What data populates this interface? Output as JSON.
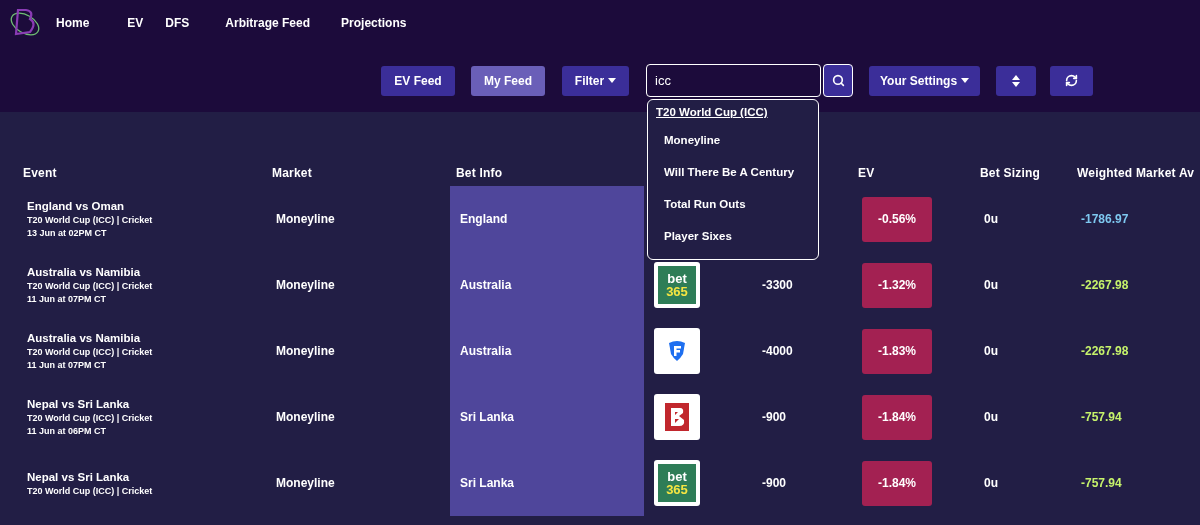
{
  "nav": {
    "items": [
      {
        "label": "Home"
      },
      {
        "label": "EV"
      },
      {
        "label": "DFS"
      },
      {
        "label": "Arbitrage Feed"
      },
      {
        "label": "Projections"
      }
    ]
  },
  "toolbar": {
    "feeds": [
      {
        "label": "EV Feed",
        "selected": false
      },
      {
        "label": "My Feed",
        "selected": true
      }
    ],
    "filter": {
      "label": "Filter"
    },
    "search": {
      "value": "icc"
    },
    "settings": {
      "label": "Your Settings"
    }
  },
  "search_dropdown": {
    "group": "T20 World Cup (ICC)",
    "items": [
      {
        "label": "Moneyline"
      },
      {
        "label": "Will There Be A Century"
      },
      {
        "label": "Total Run Outs"
      },
      {
        "label": "Player Sixes"
      }
    ]
  },
  "feed": {
    "columns": [
      {
        "label": "Event"
      },
      {
        "label": "Market"
      },
      {
        "label": "Bet Info"
      },
      {},
      {},
      {
        "label": "EV"
      },
      {
        "label": "Bet Sizing"
      },
      {
        "label": "Weighted Market Av"
      }
    ],
    "rows": [
      {
        "event": "England vs Oman",
        "league": "T20 World Cup (ICC) | Cricket",
        "time": "13 Jun at 02PM CT",
        "market": "Moneyline",
        "bet_info": "England",
        "ev": "-0.56%",
        "sizing": "0u",
        "weighted": "-1786.97",
        "color": "#7ec8f0"
      },
      {
        "event": "Australia vs Namibia",
        "league": "T20 World Cup (ICC) | Cricket",
        "time": "11 Jun at 07PM CT",
        "market": "Moneyline",
        "bet_info": "Australia",
        "book": {
          "kind": "bet365",
          "logo_text": [
            "bet",
            "365"
          ]
        },
        "price": "-3300",
        "ev": "-1.32%",
        "sizing": "0u",
        "weighted": "-2267.98",
        "color": "#c6f36b"
      },
      {
        "event": "Australia vs Namibia",
        "league": "T20 World Cup (ICC) | Cricket",
        "time": "11 Jun at 07PM CT",
        "market": "Moneyline",
        "bet_info": "Australia",
        "book": {
          "kind": "shield"
        },
        "price": "-4000",
        "ev": "-1.83%",
        "sizing": "0u",
        "weighted": "-2267.98",
        "color": "#c6f36b"
      },
      {
        "event": "Nepal vs Sri Lanka",
        "league": "T20 World Cup (ICC) | Cricket",
        "time": "11 Jun at 06PM CT",
        "market": "Moneyline",
        "bet_info": "Sri Lanka",
        "book": {
          "kind": "redb"
        },
        "price": "-900",
        "ev": "-1.84%",
        "sizing": "0u",
        "weighted": "-757.94",
        "color": "#c6f36b"
      },
      {
        "event": "Nepal vs Sri Lanka",
        "league": "T20 World Cup (ICC) | Cricket",
        "market": "Moneyline",
        "bet_info": "Sri Lanka",
        "book": {
          "kind": "bet365",
          "logo_text": [
            "bet",
            "365"
          ]
        },
        "price": "-900",
        "ev": "-1.84%",
        "sizing": "0u",
        "weighted": "-757.94",
        "color": "#c6f36b"
      }
    ]
  }
}
